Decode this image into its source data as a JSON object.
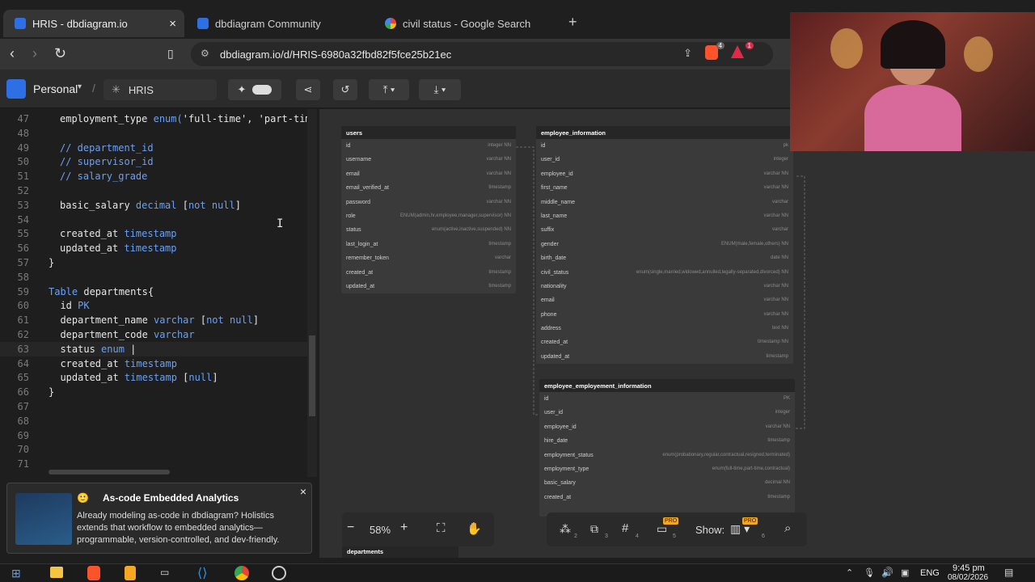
{
  "browser": {
    "tabs": [
      {
        "label": "HRIS - dbdiagram.io",
        "icon": "dbdiagram-icon"
      },
      {
        "label": "dbdiagram Community",
        "icon": "dbdiagram-icon"
      },
      {
        "label": "civil status - Google Search",
        "icon": "google-icon"
      }
    ],
    "url": "dbdiagram.io/d/HRIS-6980a32fbd82f5fce25b21ec",
    "ext_badges": [
      "4",
      "1"
    ]
  },
  "app": {
    "workspace": "Personal",
    "separator": "/",
    "diagram_name": "HRIS"
  },
  "editor": {
    "lines": [
      {
        "n": "47",
        "parts": [
          {
            "t": "employment_type ",
            "c": "st"
          },
          {
            "t": "enum(",
            "c": "tp"
          },
          {
            "t": "'full-time', 'part-time",
            "c": "st"
          }
        ]
      },
      {
        "n": "48",
        "parts": []
      },
      {
        "n": "49",
        "parts": [
          {
            "t": "// department_id",
            "c": "cm"
          }
        ]
      },
      {
        "n": "50",
        "parts": [
          {
            "t": "// supervisor_id",
            "c": "cm"
          }
        ]
      },
      {
        "n": "51",
        "parts": [
          {
            "t": "// salary_grade",
            "c": "cm"
          }
        ]
      },
      {
        "n": "52",
        "parts": []
      },
      {
        "n": "53",
        "parts": [
          {
            "t": "basic_salary ",
            "c": "st"
          },
          {
            "t": "decimal ",
            "c": "tp"
          },
          {
            "t": "[",
            "c": "st"
          },
          {
            "t": "not null",
            "c": "tp"
          },
          {
            "t": "]",
            "c": "st"
          }
        ]
      },
      {
        "n": "54",
        "parts": []
      },
      {
        "n": "55",
        "parts": [
          {
            "t": "created_at ",
            "c": "st"
          },
          {
            "t": "timestamp",
            "c": "tp"
          }
        ]
      },
      {
        "n": "56",
        "parts": [
          {
            "t": "updated_at ",
            "c": "st"
          },
          {
            "t": "timestamp",
            "c": "tp"
          }
        ]
      },
      {
        "n": "57",
        "parts": [
          {
            "t": "}",
            "c": "st"
          }
        ]
      },
      {
        "n": "58",
        "parts": []
      },
      {
        "n": "59",
        "parts": [
          {
            "t": "Table ",
            "c": "kw"
          },
          {
            "t": "departments{",
            "c": "st"
          }
        ]
      },
      {
        "n": "60",
        "parts": [
          {
            "t": "  id ",
            "c": "st"
          },
          {
            "t": "PK",
            "c": "tp"
          }
        ]
      },
      {
        "n": "61",
        "parts": [
          {
            "t": "  department_name ",
            "c": "st"
          },
          {
            "t": "varchar ",
            "c": "tp"
          },
          {
            "t": "[",
            "c": "st"
          },
          {
            "t": "not null",
            "c": "tp"
          },
          {
            "t": "]",
            "c": "st"
          }
        ]
      },
      {
        "n": "62",
        "parts": [
          {
            "t": "  department_code ",
            "c": "st"
          },
          {
            "t": "varchar",
            "c": "tp"
          }
        ]
      },
      {
        "n": "63",
        "parts": [
          {
            "t": "  status ",
            "c": "st"
          },
          {
            "t": "enum ",
            "c": "tp"
          },
          {
            "t": "|",
            "c": "st"
          }
        ]
      },
      {
        "n": "64",
        "parts": [
          {
            "t": "  created_at ",
            "c": "st"
          },
          {
            "t": "timestamp",
            "c": "tp"
          }
        ]
      },
      {
        "n": "65",
        "parts": [
          {
            "t": "  updated_at ",
            "c": "st"
          },
          {
            "t": "timestamp ",
            "c": "tp"
          },
          {
            "t": "[",
            "c": "st"
          },
          {
            "t": "null",
            "c": "tp"
          },
          {
            "t": "]",
            "c": "st"
          }
        ]
      },
      {
        "n": "66",
        "parts": [
          {
            "t": "}",
            "c": "st"
          }
        ]
      },
      {
        "n": "67",
        "parts": []
      },
      {
        "n": "68",
        "parts": []
      },
      {
        "n": "69",
        "parts": []
      },
      {
        "n": "70",
        "parts": []
      },
      {
        "n": "71",
        "parts": []
      }
    ]
  },
  "diagram": {
    "users": {
      "title": "users",
      "rows": [
        [
          "id",
          "integer  NN"
        ],
        [
          "username",
          "varchar  NN"
        ],
        [
          "email",
          "varchar  NN"
        ],
        [
          "email_verified_at",
          "timestamp"
        ],
        [
          "password",
          "varchar  NN"
        ],
        [
          "role",
          "ENUM(admin,hr,employee,manager,supervisor)  NN"
        ],
        [
          "status",
          "enum(active,inactive,suspended)  NN"
        ],
        [
          "last_login_at",
          "timestamp"
        ],
        [
          "remember_token",
          "varchar"
        ],
        [
          "created_at",
          "timestamp"
        ],
        [
          "updated_at",
          "timestamp"
        ]
      ]
    },
    "employee_information": {
      "title": "employee_information",
      "rows": [
        [
          "id",
          "pk"
        ],
        [
          "user_id",
          "integer"
        ],
        [
          "employee_id",
          "varchar  NN"
        ],
        [
          "first_name",
          "varchar  NN"
        ],
        [
          "middle_name",
          "varchar"
        ],
        [
          "last_name",
          "varchar  NN"
        ],
        [
          "suffix",
          "varchar"
        ],
        [
          "gender",
          "ENUM(male,female,others)  NN"
        ],
        [
          "birth_date",
          "date  NN"
        ],
        [
          "civil_status",
          "enum(single,married,widowed,annulled,legally-separated,divorced)  NN"
        ],
        [
          "nationality",
          "varchar  NN"
        ],
        [
          "email",
          "varchar  NN"
        ],
        [
          "phone",
          "varchar  NN"
        ],
        [
          "address",
          "text  NN"
        ],
        [
          "created_at",
          "timestamp  NN"
        ],
        [
          "updated_at",
          "timestamp"
        ]
      ]
    },
    "employee_employement_information": {
      "title": "employee_employement_information",
      "rows": [
        [
          "id",
          "PK"
        ],
        [
          "user_id",
          "integer"
        ],
        [
          "employee_id",
          "varchar  NN"
        ],
        [
          "hire_date",
          "timestamp"
        ],
        [
          "employment_status",
          "enum(probationary,regular,contractual,resigned,terminated)"
        ],
        [
          "employment_type",
          "enum(full-time,part-time,contractual)"
        ],
        [
          "basic_salary",
          "decimal  NN"
        ],
        [
          "created_at",
          "timestamp"
        ]
      ]
    },
    "departments": {
      "title": "departments"
    }
  },
  "zoom": {
    "minus": "−",
    "level": "58%",
    "plus": "+"
  },
  "toolbar": {
    "show_label": "Show:",
    "pro_badge": "PRO",
    "sub_numbers": [
      "2",
      "3",
      "4",
      "5",
      "6"
    ]
  },
  "promo": {
    "title": "As-code Embedded Analytics",
    "body": "Already modeling as-code in dbdiagram? Holistics extends that workflow to embedded analytics—programmable, version-controlled, and dev-friendly.",
    "close": "×"
  },
  "taskbar": {
    "lang": "ENG",
    "time": "9:45 pm",
    "date": "08/02/2026"
  },
  "colors": {
    "accent": "#6aa0f5",
    "brand": "#2f6fe4"
  }
}
